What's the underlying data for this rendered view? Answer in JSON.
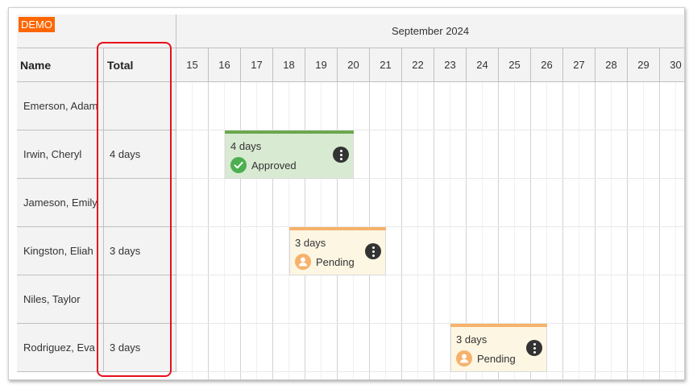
{
  "badge": "DEMO",
  "columns": {
    "name": "Name",
    "total": "Total"
  },
  "month": "September 2024",
  "days": [
    "15",
    "16",
    "17",
    "18",
    "19",
    "20",
    "21",
    "22",
    "23",
    "24",
    "25",
    "26",
    "27",
    "28",
    "29",
    "30"
  ],
  "rows": [
    {
      "name": "Emerson, Adam",
      "total": ""
    },
    {
      "name": "Irwin, Cheryl",
      "total": "4 days"
    },
    {
      "name": "Jameson, Emily",
      "total": ""
    },
    {
      "name": "Kingston, Eliah",
      "total": "3 days"
    },
    {
      "name": "Niles, Taylor",
      "total": ""
    },
    {
      "name": "Rodriguez, Eva",
      "total": "3 days"
    }
  ],
  "events": [
    {
      "person": "Irwin, Cheryl",
      "start_day": "16",
      "end_day": "19",
      "duration": "4 days",
      "status": "Approved",
      "bar_color": "#6aa84f",
      "bg_color": "#d9ead3",
      "icon": "check-circle-icon",
      "icon_color": "#4caf50"
    },
    {
      "person": "Kingston, Eliah",
      "start_day": "18",
      "end_day": "20",
      "duration": "3 days",
      "status": "Pending",
      "bar_color": "#f6b26b",
      "bg_color": "#fdf6e3",
      "icon": "person-circle-icon",
      "icon_color": "#f6b26b"
    },
    {
      "person": "Rodriguez, Eva",
      "start_day": "23",
      "end_day": "25",
      "duration": "3 days",
      "status": "Pending",
      "bar_color": "#f6b26b",
      "bg_color": "#fdf6e3",
      "icon": "person-circle-icon",
      "icon_color": "#f6b26b"
    }
  ],
  "colors": {
    "highlight": "#e8101c",
    "demo_badge": "#ff6600"
  }
}
